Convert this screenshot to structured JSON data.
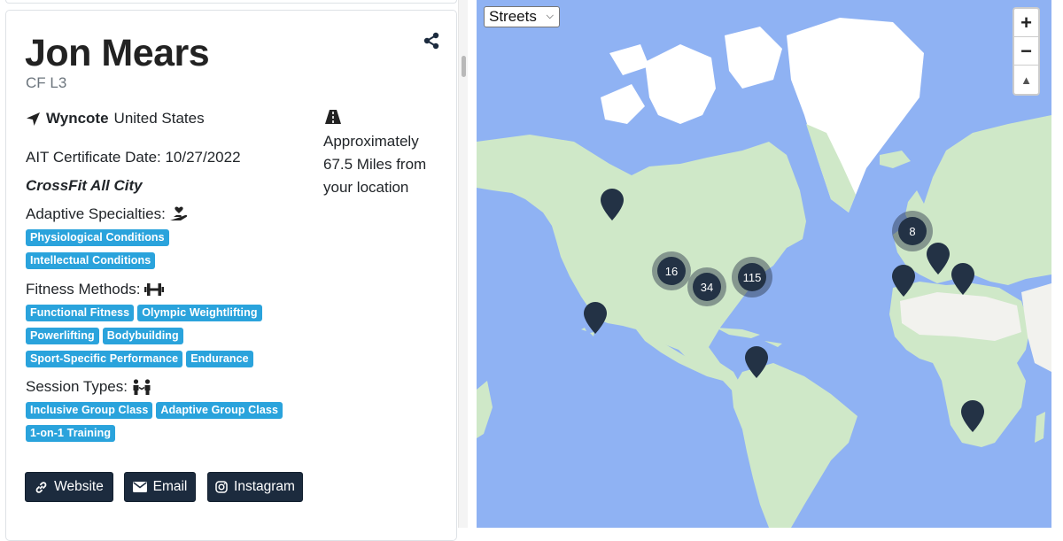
{
  "profile": {
    "name": "Jon Mears",
    "cert_level": "CF L3",
    "city": "Wyncote",
    "country": "United States",
    "distance_text": "Approximately 67.5 Miles from your location",
    "ait_date": "AIT Certificate Date: 10/27/2022",
    "gym": "CrossFit All City"
  },
  "sections": {
    "adaptive": {
      "title": "Adaptive Specialties:",
      "badges": [
        "Physiological Conditions",
        "Intellectual Conditions"
      ]
    },
    "fitness": {
      "title": "Fitness Methods:",
      "badges": [
        "Functional Fitness",
        "Olympic Weightlifting",
        "Powerlifting",
        "Bodybuilding",
        "Sport-Specific Performance",
        "Endurance"
      ]
    },
    "session": {
      "title": "Session Types:",
      "badges": [
        "Inclusive Group Class",
        "Adaptive Group Class",
        "1-on-1 Training"
      ]
    }
  },
  "buttons": {
    "website": "Website",
    "email": "Email",
    "instagram": "Instagram"
  },
  "map": {
    "layer": "Streets",
    "zoom_in": "+",
    "zoom_out": "−",
    "reset_bearing": "▲",
    "clusters": [
      "16",
      "34",
      "115",
      "8"
    ]
  },
  "colors": {
    "badge": "#2aa3dc",
    "button": "#1c2b3e",
    "ocean": "#8fb2f3",
    "land": "#cfe8c8",
    "marker": "#233245"
  },
  "icons": [
    "share-icon",
    "location-arrow-icon",
    "road-icon",
    "hand-holding-heart-icon",
    "dumbbell-icon",
    "people-icon",
    "link-icon",
    "envelope-icon",
    "instagram-icon"
  ]
}
